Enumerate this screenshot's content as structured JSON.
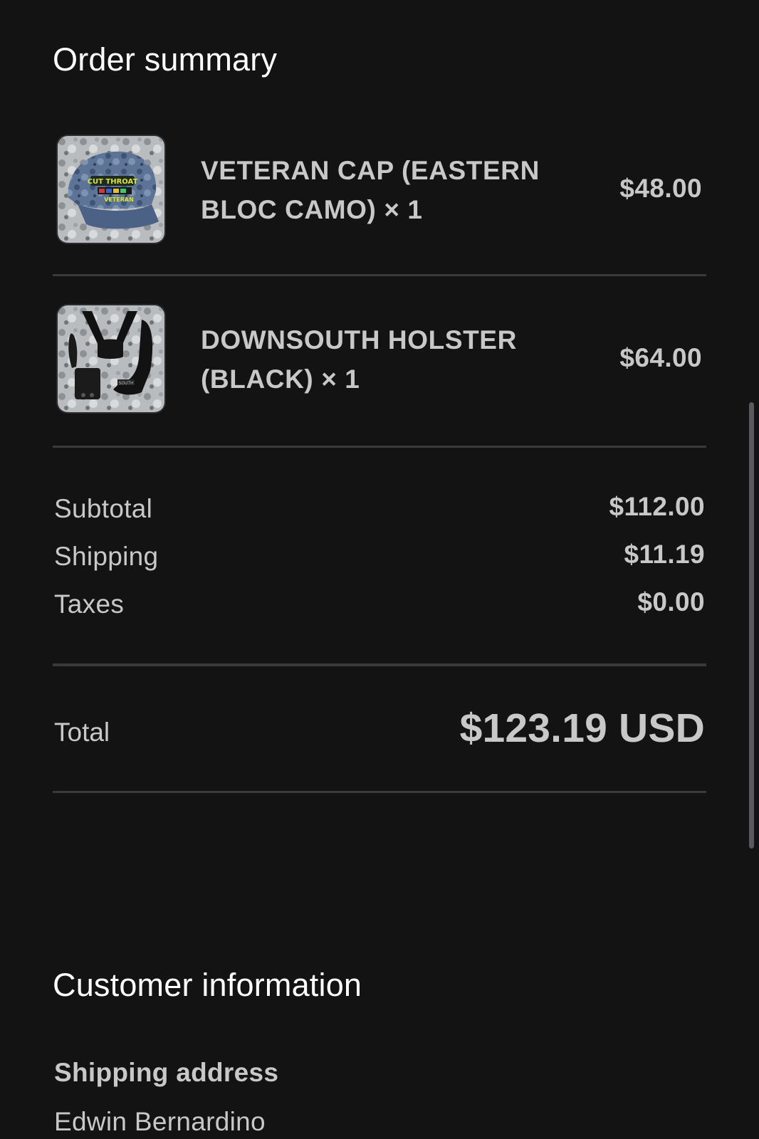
{
  "order_summary": {
    "title": "Order summary",
    "items": [
      {
        "name": "VETERAN CAP (EASTERN BLOC CAMO) × 1",
        "price": "$48.00",
        "thumbnail_icon": "camo-cap-image"
      },
      {
        "name": "DOWNSOUTH HOLSTER (BLACK) × 1",
        "price": "$64.00",
        "thumbnail_icon": "holster-image"
      }
    ],
    "rows": [
      {
        "label": "Subtotal",
        "value": "$112.00"
      },
      {
        "label": "Shipping",
        "value": "$11.19"
      },
      {
        "label": "Taxes",
        "value": "$0.00"
      }
    ],
    "total": {
      "label": "Total",
      "value": "$123.19 USD"
    }
  },
  "customer_information": {
    "title": "Customer information",
    "shipping_address_label": "Shipping address",
    "name": "Edwin Bernardino"
  },
  "colors": {
    "background": "#131314",
    "heading_text": "#ffffff",
    "body_text": "#c8c8c8",
    "divider": "#3a3a3c"
  }
}
